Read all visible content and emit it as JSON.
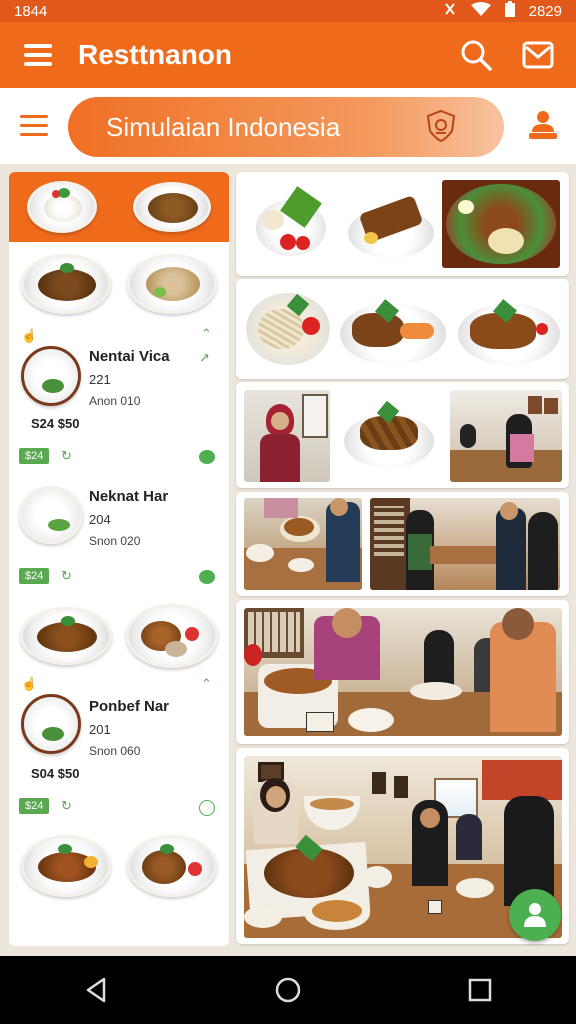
{
  "status_bar": {
    "time": "1844",
    "right_text": "2829"
  },
  "app_bar": {
    "title": "Resttnanon"
  },
  "search": {
    "text": "Simulaian Indonesia"
  },
  "left_panel": {
    "items": [
      {
        "name": "Nentai Vica",
        "number": "221",
        "sub": "Anon 010",
        "price": "S24 $50",
        "badge": "$24"
      },
      {
        "name": "Neknat Har",
        "number": "204",
        "sub": "Snon 020",
        "badge": "$24"
      },
      {
        "name": "Ponbef Nar",
        "number": "201",
        "sub": "Snon 060",
        "price": "S04 $50",
        "badge": "$24"
      }
    ]
  },
  "colors": {
    "primary": "#f06a1c",
    "accent": "#4caf50",
    "status_bar": "#e2581a"
  },
  "icons": {
    "menu": "menu-icon",
    "search": "search-icon",
    "mail": "mail-icon",
    "hamburger": "hamburger-icon",
    "badge": "shield-icon",
    "person": "person-icon",
    "back": "back-icon",
    "home": "home-icon",
    "recents": "recents-icon"
  }
}
